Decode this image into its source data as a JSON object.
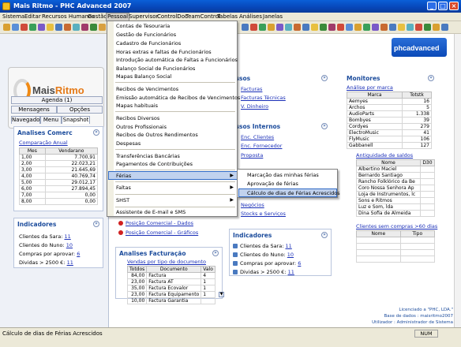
{
  "window": {
    "title": "Mais Ritmo - PHC Advanced 2007"
  },
  "menubar": [
    "Sistema",
    "Editar",
    "Recursos Humanos",
    "Gestão",
    "Pessoal",
    "Supervisor",
    "ControlDoc",
    "TeamControl",
    "Tabelas",
    "Análises",
    "Janelas"
  ],
  "left": {
    "logo_brand_a": "Mais",
    "logo_brand_b": "Ritmo",
    "agenda": "Agenda (1)",
    "mensagens": "Mensagens",
    "opcoes": "Opções",
    "tabs": [
      "Navegador",
      "Menu",
      "Snapshot"
    ],
    "analises_title": "Analises Comerc",
    "comparacao_link": "Comparação Anual",
    "cols": [
      "Mes",
      "Vendarano"
    ],
    "rows": [
      [
        "1,00",
        "7.700,91"
      ],
      [
        "2,00",
        "22.023,21"
      ],
      [
        "3,00",
        "21.645,69"
      ],
      [
        "4,00",
        "40.769,74"
      ],
      [
        "5,00",
        "29.012,17"
      ],
      [
        "6,00",
        "27.894,45"
      ],
      [
        "7,00",
        "0,00"
      ],
      [
        "8,00",
        "0,00"
      ]
    ],
    "indicadores_title": "Indicadores",
    "ind": [
      {
        "label": "Clientes da Sara:",
        "value": "11"
      },
      {
        "label": "Clientes do Nuno:",
        "value": "10"
      },
      {
        "label": "Compras por aprovar:",
        "value": "6"
      },
      {
        "label": "Dividas > 2500 €:",
        "value": "11"
      }
    ]
  },
  "dropdown": {
    "items": [
      "Contas de Tesouraria",
      "Gestão de Funcionários",
      "Cadastro de Funcionários",
      "Horas extras e faltas de Funcionários",
      "Introdução automática de Faltas a Funcionários",
      "Balanço Social de Funcionários",
      "Mapas Balanço Social",
      "Recibos de Vencimentos",
      "Emissão automática de Recibos de Vencimentos",
      "Mapas habituais",
      "Recibos Diversos",
      "Outros Profissionais",
      "Recibos de Outros Rendimentos",
      "Despesas",
      "Transferências Bancárias",
      "Pagamentos de Contribuições",
      "Férias",
      "Faltas",
      "SHST",
      "Assistente de E-mail e SMS"
    ]
  },
  "submenu": {
    "items": [
      "Marcação das minhas férias",
      "Aprovação de férias",
      "Cálculo de dias de Férias Acrescidos"
    ]
  },
  "middle": {
    "acessos_title": "cessos",
    "acessos_links": [
      "Facturas",
      "Facturas Técnicas",
      "V. Dinheiro"
    ],
    "acessos_int_title": "cessos Internos",
    "acessos_int_links": [
      "Enc. Clientes",
      "Enc. Fornecedor",
      "Proposta"
    ],
    "neg_links": [
      "Negócios",
      "Stocks e Serviços"
    ],
    "posicao_links": [
      "Posição Comercial - Dados",
      "Posição Comercial - Gráficos"
    ],
    "analises_fact_title": "Analises Facturação",
    "vendas_link": "Vendas por tipo de documento",
    "fact_cols": [
      "Totdos",
      "Documento",
      "Valo"
    ],
    "fact_rows": [
      [
        "84,00",
        "Factura",
        "4"
      ],
      [
        "23,00",
        "Factura AT",
        "1"
      ],
      [
        "35,00",
        "Factura Ecovalor",
        "1"
      ],
      [
        "23,00",
        "Factura Equipamento",
        "1"
      ],
      [
        "10,00",
        "Factura Garantia",
        ""
      ]
    ],
    "indicadores_title": "Indicadores",
    "ind": [
      {
        "label": "Clientes da Sara:",
        "value": "11"
      },
      {
        "label": "Clientes do Nuno:",
        "value": "10"
      },
      {
        "label": "Compras por aprovar:",
        "value": "6"
      },
      {
        "label": "Dividas > 2500 €:",
        "value": "11"
      }
    ]
  },
  "right": {
    "brand": "phcadvanced",
    "monitores_title": "Monitores",
    "analise_link": "Análise por marca",
    "marca_cols": [
      "Marca",
      "Totstk"
    ],
    "marca_rows": [
      [
        "Aemyes",
        "16"
      ],
      [
        "Archos",
        "5"
      ],
      [
        "AudioParts",
        "1.338"
      ],
      [
        "Bombyes",
        "39"
      ],
      [
        "Cordyes",
        "279"
      ],
      [
        "ElectroMusic",
        "41"
      ],
      [
        "FlyMusic",
        "106"
      ],
      [
        "Gabbanell",
        "127"
      ]
    ],
    "antiguidade_link": "Antiguidade de saldos",
    "saldo_cols": [
      "Nome",
      "D30"
    ],
    "saldo_rows": [
      "Albertino Maciel",
      "Bernardo Santiago",
      "Rancho Folklórico da Be",
      "Coro Nossa Senhora Ap",
      "Loja de Instrumentos, lc",
      "Sons e Ritmos",
      "Luz e Som, lda",
      "Dina Sofia de Almeida"
    ],
    "clientes_link": "Clientes sem compras >60 dias",
    "cli_cols": [
      "Nome",
      "Tipo"
    ]
  },
  "footer": {
    "lic1": "Licenciado a \"PHC, LDA.\"",
    "lic2": "Base de dados : maisritmo2007",
    "lic3": "Utilizador : Administrador de Sistema"
  },
  "status": {
    "text": "Cálculo de dias de Férias Acrescidos",
    "num": "NUM"
  }
}
